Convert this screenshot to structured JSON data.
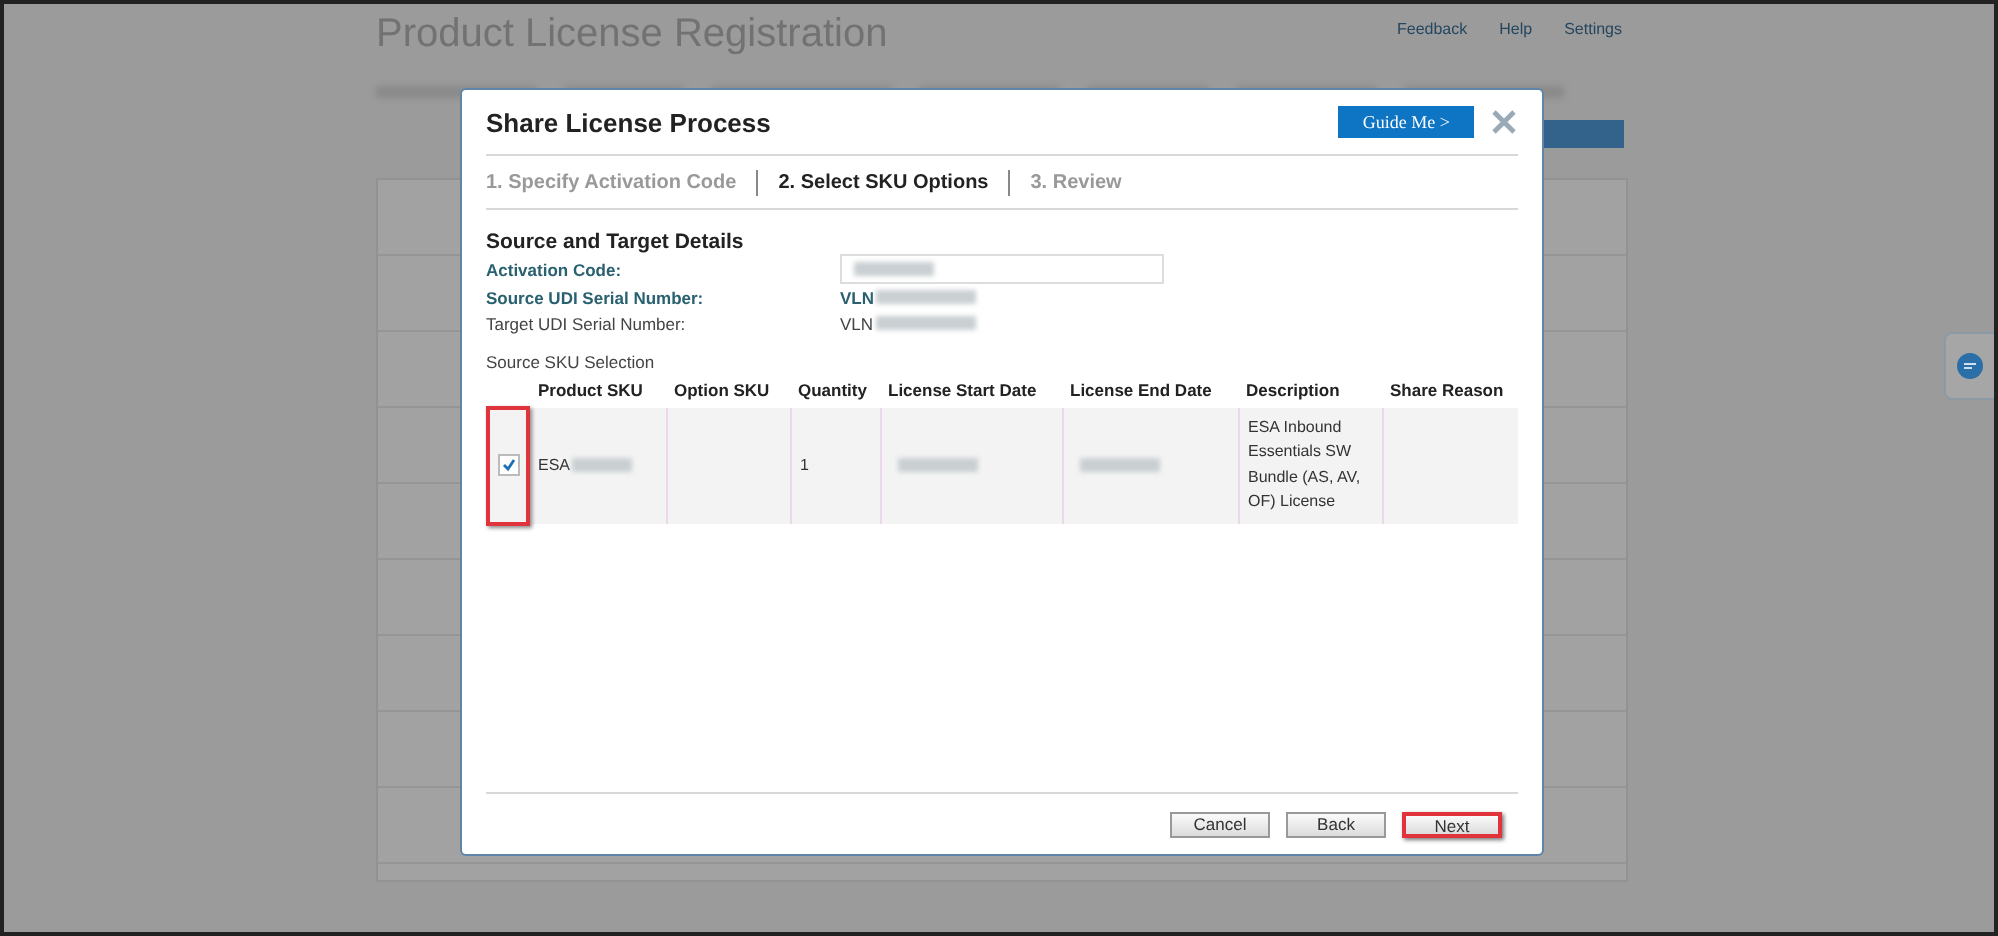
{
  "background": {
    "title": "Product License Registration",
    "links": [
      "Feedback",
      "Help",
      "Settings"
    ]
  },
  "dialog": {
    "title": "Share License Process",
    "guide_button": "Guide Me >",
    "steps": [
      {
        "label": "1. Specify Activation Code",
        "selected": false
      },
      {
        "label": "2. Select SKU Options",
        "selected": true
      },
      {
        "label": "3. Review",
        "selected": false
      }
    ],
    "section_title": "Source and Target Details",
    "details": [
      {
        "kind": "field",
        "label": "Activation Code:",
        "emphasis": true
      },
      {
        "kind": "text",
        "label": "Source UDI Serial Number:",
        "value": "VLN",
        "emphasis": true
      },
      {
        "kind": "text",
        "label": "Target UDI Serial Number:",
        "value": "VLN",
        "emphasis": false
      }
    ],
    "table": {
      "caption": "Source SKU Selection",
      "columns": [
        "Product SKU",
        "Option SKU",
        "Quantity",
        "License Start Date",
        "License End Date",
        "Description",
        "Share Reason"
      ],
      "rows": [
        {
          "checked": true,
          "highlighted": true,
          "product_sku": "ESA",
          "quantity": "1",
          "description": "ESA Inbound Essentials SW Bundle (AS, AV, OF) License"
        }
      ]
    },
    "buttons": [
      {
        "label": "Cancel",
        "highlighted": false
      },
      {
        "label": "Back",
        "highlighted": false
      },
      {
        "label": "Next",
        "highlighted": true
      }
    ]
  }
}
